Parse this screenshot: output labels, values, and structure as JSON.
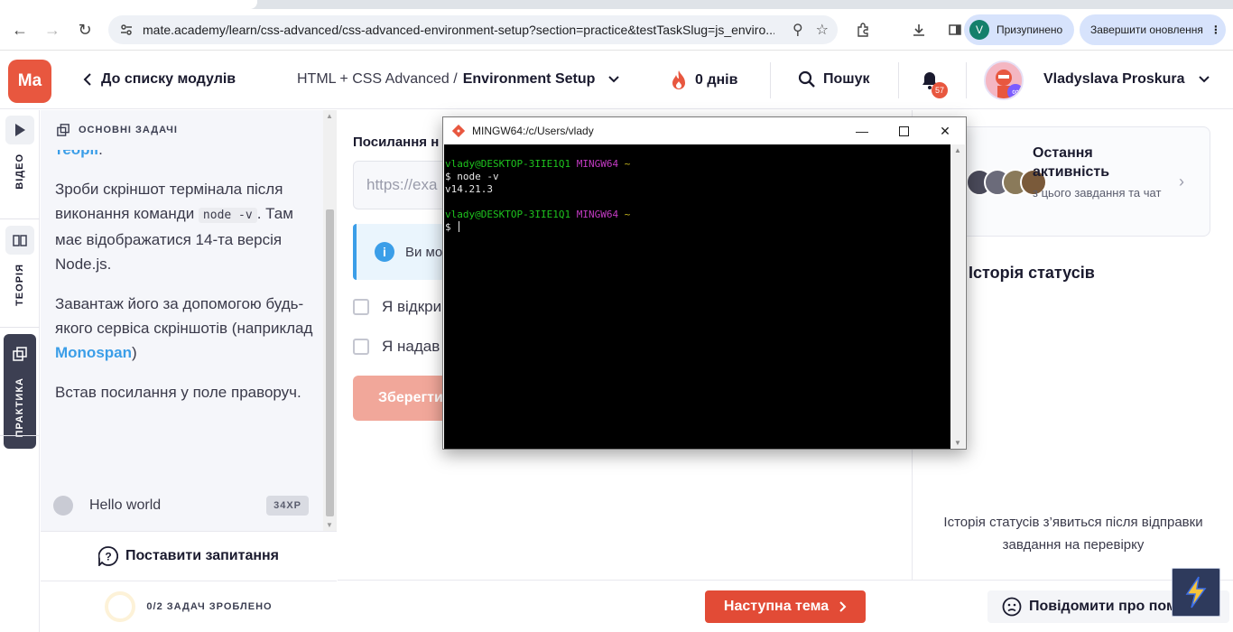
{
  "browser": {
    "url": "mate.academy/learn/css-advanced/css-advanced-environment-setup?section=practice&testTaskSlug=js_enviro...",
    "profile_initial": "V",
    "profile_label": "Призупинено",
    "update_label": "Завершити оновлення"
  },
  "header": {
    "logo": "Ma",
    "back_label": "До списку модулів",
    "course_prefix": "HTML + CSS Advanced / ",
    "course_topic": "Environment Setup",
    "streak": "0 днів",
    "search_label": "Пошук",
    "notif_count": "57",
    "user_name": "Vladyslava Proskura"
  },
  "rail": {
    "video": "ВІДЕО",
    "theory": "ТЕОРІЯ",
    "practice": "ПРАКТИКА"
  },
  "task": {
    "header": "ОСНОВНІ ЗАДАЧІ",
    "cut_link": "теорії",
    "cut_tail": ".",
    "p1_a": "Зроби скріншот термінала після виконання команди ",
    "p1_code": "node -v",
    "p1_b": ". Там має відображатися 14-та версія Node.js.",
    "p2_a": "Завантаж його за допомогою будь-якого сервіса скріншотів (наприклад ",
    "p2_link": "Monospan",
    "p2_b": ")",
    "p3": "Встав посилання у поле праворуч.",
    "hello_label": "Hello world",
    "hello_xp": "34XP",
    "ask_label": "Поставити запитання",
    "progress_label": "0/2 ЗАДАЧ ЗРОБЛЕНО"
  },
  "form": {
    "label": "Посилання н",
    "input_placeholder": "https://exa",
    "info": "Ви мо",
    "check1": "Я відкри",
    "check2": "Я надав",
    "save": "Зберегти"
  },
  "right": {
    "activity_title": "Остання активність",
    "activity_sub": "з цього завдання та чат",
    "status_title": "Історія статусів",
    "status_empty": "Історія статусів з’явиться після відправки завдання на перевірку"
  },
  "footer": {
    "next": "Наступна тема",
    "report": "Повідомити про помилку"
  },
  "terminal": {
    "title": "MINGW64:/c/Users/vlady",
    "prompt_user": "vlady@DESKTOP-3IIE1Q1",
    "prompt_env": "MINGW64",
    "prompt_dir": "~",
    "command": "$ node -v",
    "output": "v14.21.3",
    "prompt2": "$ "
  },
  "colors": {
    "brand": "#e8573f",
    "link": "#3b9ee8",
    "next_button": "#e24b36",
    "save_button_disabled": "#f1a79a"
  }
}
